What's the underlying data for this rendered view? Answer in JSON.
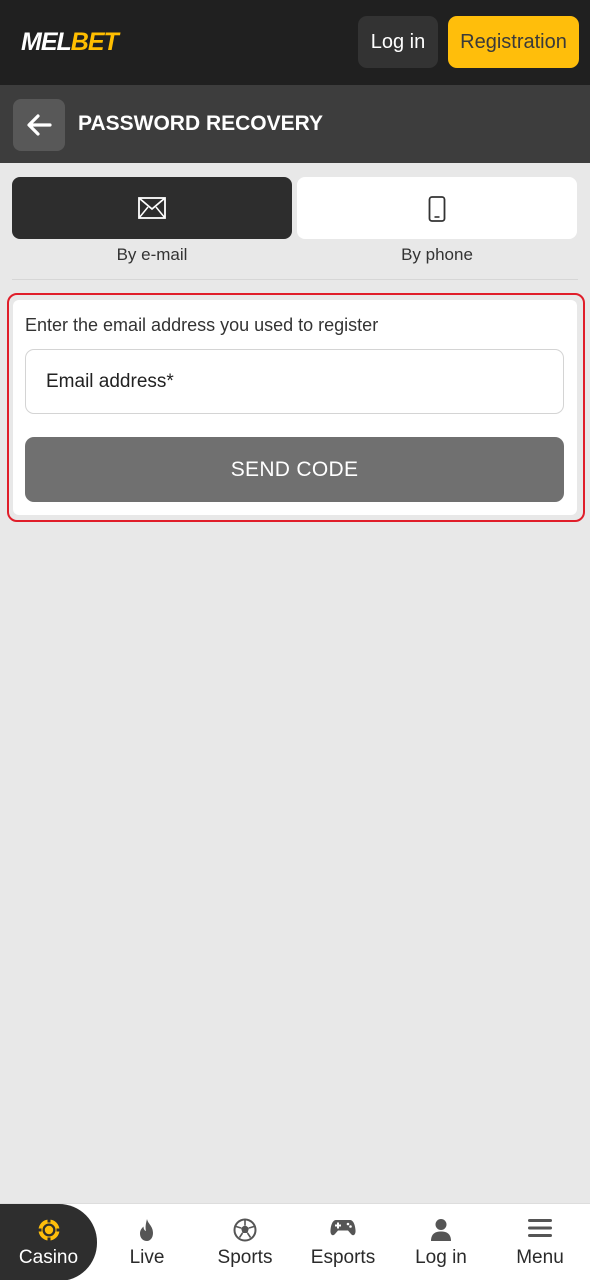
{
  "header": {
    "logo_part1": "MEL",
    "logo_part2": "BET",
    "login_label": "Log in",
    "register_label": "Registration"
  },
  "page": {
    "title": "PASSWORD RECOVERY"
  },
  "tabs": [
    {
      "label": "By e-mail",
      "icon": "envelope-icon",
      "active": true
    },
    {
      "label": "By phone",
      "icon": "phone-icon",
      "active": false
    }
  ],
  "form": {
    "hint": "Enter the email address you used to register",
    "email_placeholder": "Email address*",
    "email_value": "",
    "submit_label": "SEND CODE"
  },
  "bottom_nav": [
    {
      "label": "Casino",
      "icon": "casino-chip-icon",
      "active": true
    },
    {
      "label": "Live",
      "icon": "flame-icon",
      "active": false
    },
    {
      "label": "Sports",
      "icon": "soccer-ball-icon",
      "active": false
    },
    {
      "label": "Esports",
      "icon": "gamepad-icon",
      "active": false
    },
    {
      "label": "Log in",
      "icon": "user-icon",
      "active": false
    },
    {
      "label": "Menu",
      "icon": "hamburger-menu-icon",
      "active": false
    }
  ],
  "colors": {
    "brand_yellow": "#ffbe0b",
    "dark_bar": "#202020",
    "highlight_red": "#e01e2a",
    "button_gray": "#707070"
  }
}
